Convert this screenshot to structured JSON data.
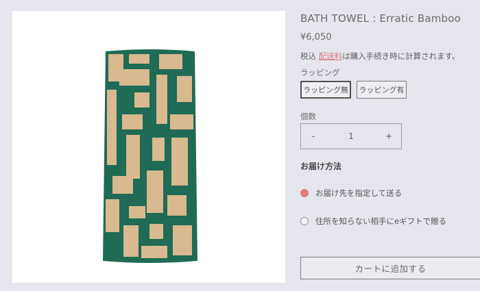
{
  "product": {
    "title": "BATH TOWEL : Erratic Bamboo",
    "price": "¥6,050",
    "tax_prefix": "税込",
    "shipping_link": "配送料",
    "tax_suffix": "は購入手続き時に計算されます。",
    "image_alt": "green and beige bath towel"
  },
  "wrapping": {
    "label": "ラッピング",
    "options": [
      "ラッピング無",
      "ラッピング有"
    ],
    "selected": "ラッピング無"
  },
  "quantity": {
    "label": "個数",
    "minus": "-",
    "value": "1",
    "plus": "+"
  },
  "delivery": {
    "title": "お届け方法",
    "options": [
      "お届け先を指定して送る",
      "住所を知らない相手にeギフトで贈る"
    ],
    "selected": "お届け先を指定して送る"
  },
  "cart": {
    "button_label": "カートに追加する"
  },
  "colors": {
    "accent": "#e17b7e",
    "towel_green": "#1f6b55",
    "towel_beige": "#d9b98f"
  }
}
